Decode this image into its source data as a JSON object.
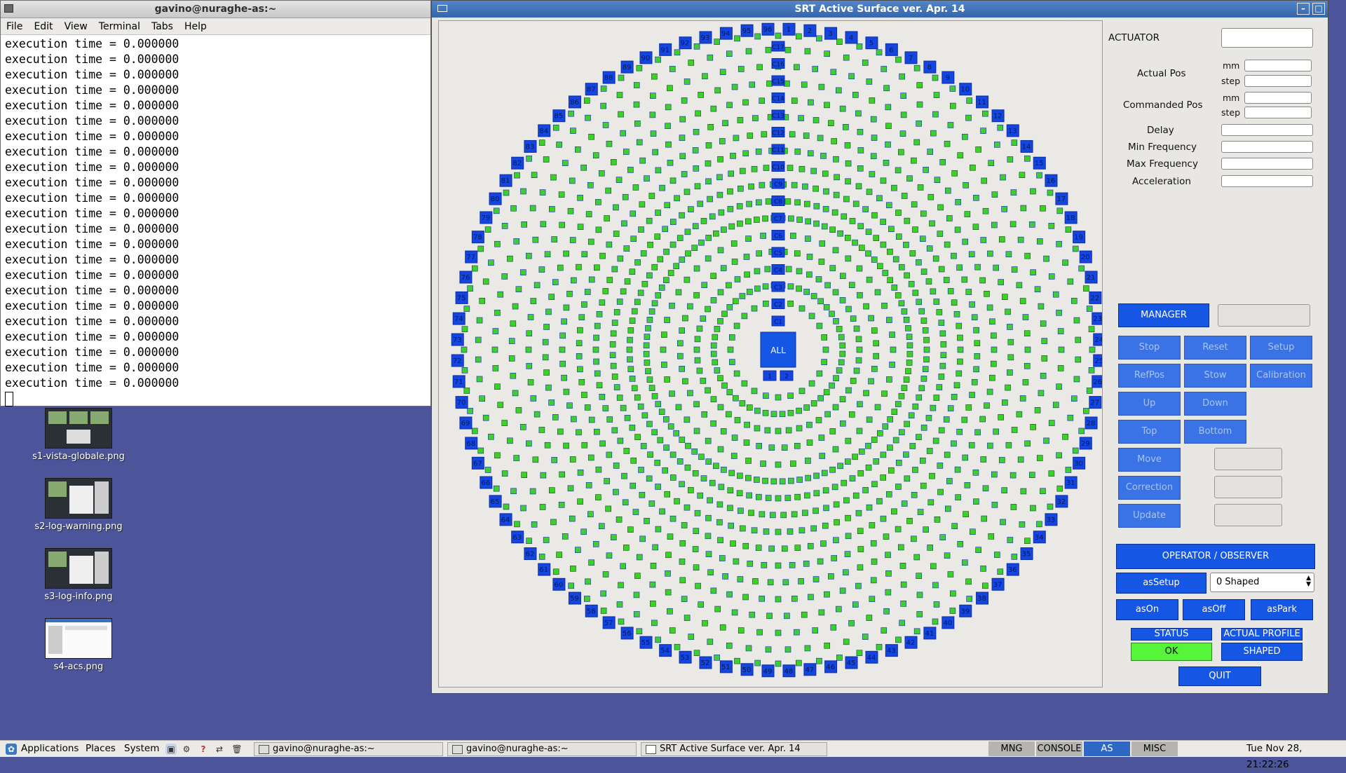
{
  "terminal": {
    "title": "gavino@nuraghe-as:~",
    "menu": [
      "File",
      "Edit",
      "View",
      "Terminal",
      "Tabs",
      "Help"
    ],
    "lines": [
      "execution time = 0.000000",
      "execution time = 0.000000",
      "execution time = 0.000000",
      "execution time = 0.000000",
      "execution time = 0.000000",
      "execution time = 0.000000",
      "execution time = 0.000000",
      "execution time = 0.000000",
      "execution time = 0.000000",
      "execution time = 0.000000",
      "execution time = 0.000000",
      "execution time = 0.000000",
      "execution time = 0.000000",
      "execution time = 0.000000",
      "execution time = 0.000000",
      "execution time = 0.000000",
      "execution time = 0.000000",
      "execution time = 0.000000",
      "execution time = 0.000000",
      "execution time = 0.000000",
      "execution time = 0.000000",
      "execution time = 0.000000",
      "execution time = 0.000000"
    ]
  },
  "desktop": {
    "icons": [
      {
        "label": "s1-vista-globale.png"
      },
      {
        "label": "s2-log-warning.png"
      },
      {
        "label": "s3-log-info.png"
      },
      {
        "label": "s4-acs.png"
      }
    ]
  },
  "srt": {
    "title": "SRT Active Surface ver. Apr. 14",
    "window_buttons": [
      "–",
      "□"
    ],
    "all_label": "ALL",
    "outer_labels_count": 96,
    "center_labels": [
      "C1",
      "C2",
      "C3",
      "C4",
      "C5",
      "C6",
      "C7",
      "C8",
      "C9",
      "C10",
      "C11",
      "C12",
      "C13",
      "C14",
      "C15",
      "C16",
      "C17"
    ],
    "mid_labels": [
      "1",
      "2"
    ],
    "actuator_color": "#3fcf2a",
    "label_color": "#1545e0",
    "fields": {
      "actuator": "ACTUATOR",
      "actual_pos": "Actual Pos",
      "commanded_pos": "Commanded Pos",
      "mm": "mm",
      "step": "step",
      "delay": "Delay",
      "min_freq": "Min Frequency",
      "max_freq": "Max Frequency",
      "acceleration": "Acceleration"
    },
    "buttons": {
      "manager": "MANAGER",
      "stop": "Stop",
      "reset": "Reset",
      "setup": "Setup",
      "refpos": "RefPos",
      "stow": "Stow",
      "calibration": "Calibration",
      "up": "Up",
      "down": "Down",
      "top": "Top",
      "bottom": "Bottom",
      "move": "Move",
      "correction": "Correction",
      "update": "Update",
      "operator": "OPERATOR / OBSERVER",
      "assetup": "asSetup",
      "ason": "asOn",
      "asoff": "asOff",
      "aspark": "asPark",
      "quit": "QUIT"
    },
    "profile_select": "0 Shaped",
    "status_label": "STATUS",
    "status_value": "OK",
    "profile_label": "ACTUAL PROFILE",
    "profile_value": "SHAPED"
  },
  "taskbar": {
    "applications": "Applications",
    "places": "Places",
    "system": "System",
    "tasks": [
      "gavino@nuraghe-as:~",
      "gavino@nuraghe-as:~",
      "SRT Active Surface ver. Apr. 14"
    ],
    "workspaces": [
      "MNG",
      "CONSOLE",
      "AS",
      "MISC"
    ],
    "clock": "Tue Nov 28, 21:22:26"
  }
}
